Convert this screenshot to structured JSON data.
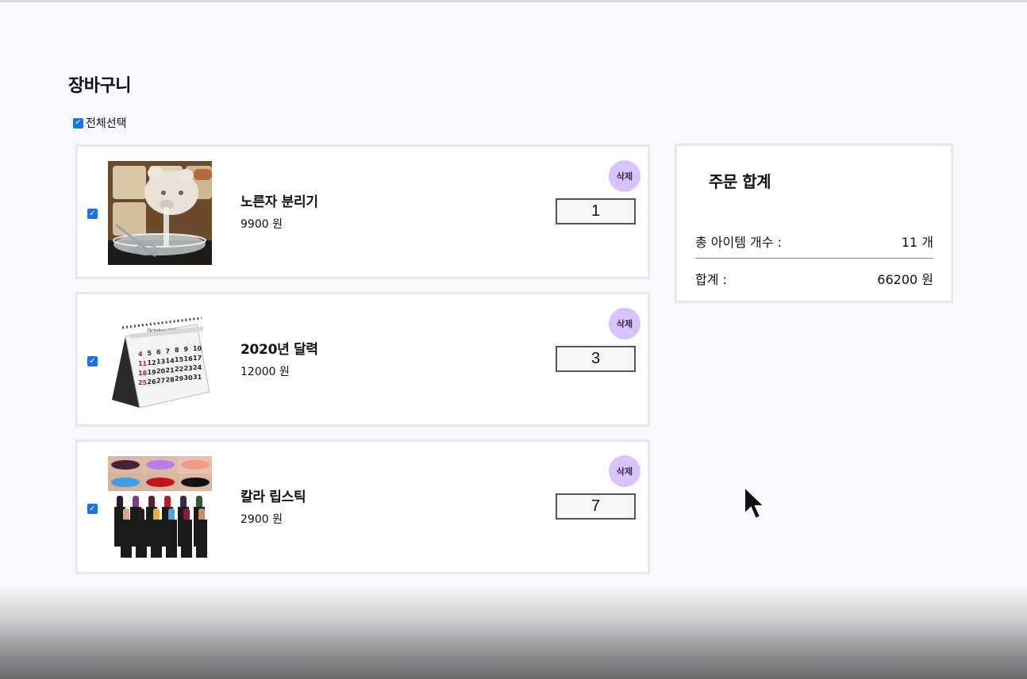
{
  "page": {
    "title": "장바구니"
  },
  "select_all": {
    "label": "전체선택",
    "checked": true
  },
  "cart_items": [
    {
      "name": "노른자 분리기",
      "price": "9900 원",
      "quantity": "1",
      "delete_label": "삭제",
      "checked": true,
      "image_icon": "egg-separator-image"
    },
    {
      "name": "2020년 달력",
      "price": "12000 원",
      "quantity": "3",
      "delete_label": "삭제",
      "checked": true,
      "image_icon": "desk-calendar-image"
    },
    {
      "name": "칼라 립스틱",
      "price": "2900 원",
      "quantity": "7",
      "delete_label": "삭제",
      "checked": true,
      "image_icon": "lipstick-set-image"
    }
  ],
  "summary": {
    "title": "주문 합계",
    "total_items_label": "총 아이템 개수 :",
    "total_items_value": "11 개",
    "total_price_label": "합계 :",
    "total_price_value": "66200 원"
  },
  "calendar_image_text": {
    "month": "October 2020",
    "days": [
      "4",
      "5",
      "6",
      "7",
      "8",
      "9",
      "10",
      "11",
      "12",
      "13",
      "14",
      "15",
      "16",
      "17",
      "18",
      "19",
      "20",
      "21",
      "22",
      "23",
      "24",
      "25",
      "26",
      "27",
      "28",
      "29",
      "30",
      "31"
    ]
  },
  "colors": {
    "accent": "#1a73e8",
    "delete_button": "#d9c2fb",
    "card_border": "#e7e7ec"
  }
}
